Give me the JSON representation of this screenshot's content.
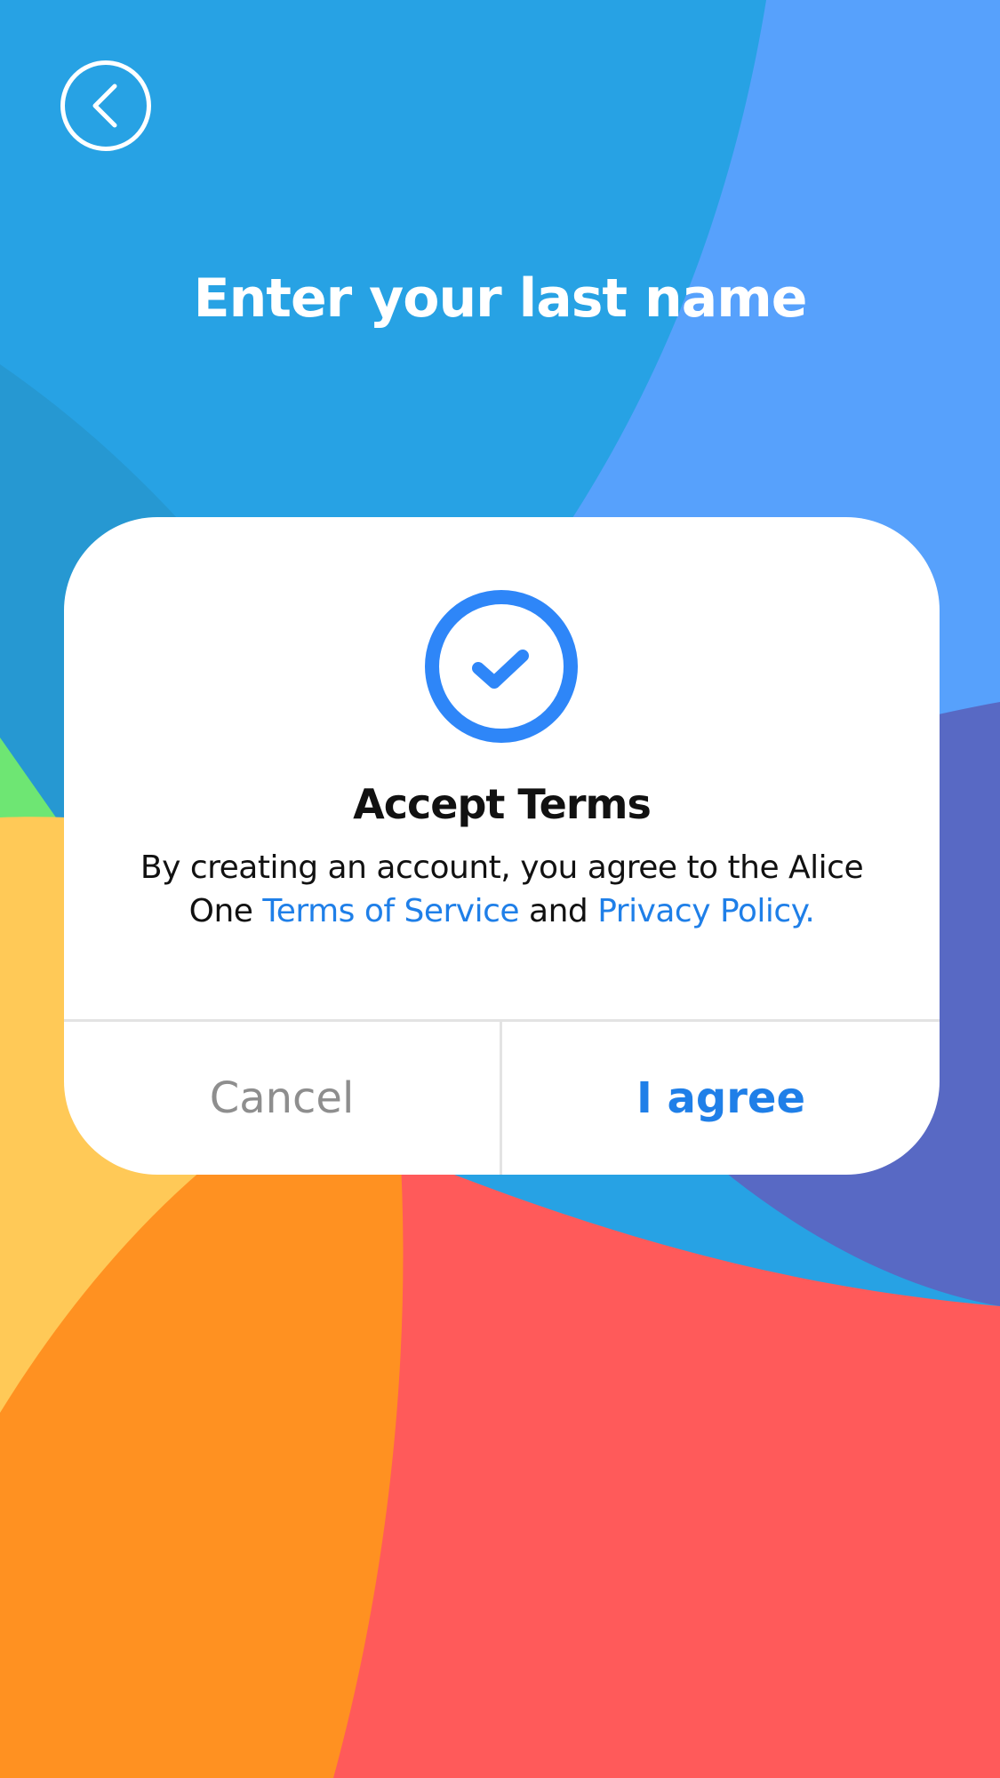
{
  "colors": {
    "bg_blue": "#27a2e4",
    "bg_light_blue": "#57a1fc",
    "bg_indigo": "#5869c4",
    "bg_teal": "#2698d2",
    "bg_green": "#6ee673",
    "bg_yellow": "#ffc957",
    "bg_orange": "#ff9121",
    "bg_red": "#ff5a5a",
    "accent": "#1f7fe8",
    "check_ring": "#2e86f8"
  },
  "header": {
    "back_icon": "chevron-left-icon",
    "title": "Enter your last name"
  },
  "dialog": {
    "icon": "check-circle-icon",
    "title": "Accept Terms",
    "body_prefix": "By creating an account, you agree to the Alice One ",
    "terms_link": "Terms of Service",
    "body_middle": " and ",
    "privacy_link": "Privacy Policy.",
    "cancel_label": "Cancel",
    "agree_label": "I agree"
  }
}
